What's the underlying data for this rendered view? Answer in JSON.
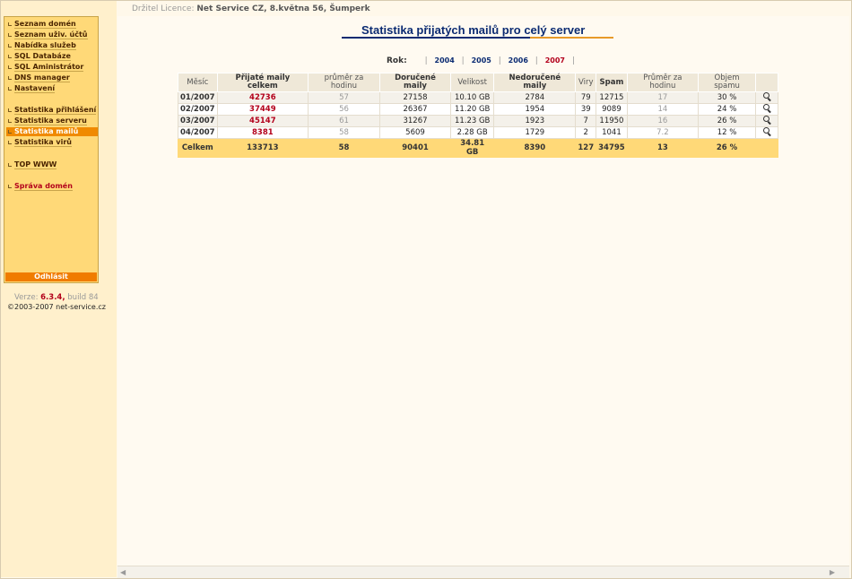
{
  "licence": {
    "label": "Držitel Licence:",
    "value": "Net Service CZ, 8.května 56, Šumperk"
  },
  "menu": {
    "items": [
      {
        "label": "Seznam domén"
      },
      {
        "label": "Seznam uživ. účtů"
      },
      {
        "label": "Nabídka služeb"
      },
      {
        "label": "SQL Databáze"
      },
      {
        "label": "SQL Aministrátor"
      },
      {
        "label": "DNS manager"
      },
      {
        "label": "Nastavení"
      },
      {
        "label": "Statistika přihlášení"
      },
      {
        "label": "Statistika serveru"
      },
      {
        "label": "Statistika mailů"
      },
      {
        "label": "Statistika virů"
      },
      {
        "label": "TOP WWW"
      },
      {
        "label": "Správa domén"
      }
    ],
    "logout": "Odhlásit"
  },
  "version": {
    "label": "Verze:",
    "number": "6.3.4,",
    "build": "build 84"
  },
  "copyright": "©2003-2007 net-service.cz",
  "page_title": "Statistika přijatých mailů pro celý server",
  "years": {
    "label": "Rok:",
    "list": [
      "2004",
      "2005",
      "2006",
      "2007"
    ]
  },
  "table": {
    "headers": [
      "Měsíc",
      "Přijaté maily celkem",
      "průměr za hodinu",
      "Doručené maily",
      "Velikost",
      "Nedoručené maily",
      "Viry",
      "Spam",
      "Průměr za hodinu",
      "Objem spamu"
    ],
    "rows": [
      [
        "01/2007",
        "42736",
        "57",
        "27158",
        "10.10 GB",
        "2784",
        "79",
        "12715",
        "17",
        "30 %"
      ],
      [
        "02/2007",
        "37449",
        "56",
        "26367",
        "11.20 GB",
        "1954",
        "39",
        "9089",
        "14",
        "24 %"
      ],
      [
        "03/2007",
        "45147",
        "61",
        "31267",
        "11.23 GB",
        "1923",
        "7",
        "11950",
        "16",
        "26 %"
      ],
      [
        "04/2007",
        "8381",
        "58",
        "5609",
        "2.28 GB",
        "1729",
        "2",
        "1041",
        "7.2",
        "12 %"
      ]
    ],
    "total": [
      "Celkem",
      "133713",
      "58",
      "90401",
      "34.81 GB",
      "8390",
      "127",
      "34795",
      "13",
      "26 %"
    ]
  },
  "colors": {
    "accent": "#f08a00",
    "title": "#0b2b72",
    "highlight": "#b3001b",
    "menu_bg": "#ffd978"
  }
}
